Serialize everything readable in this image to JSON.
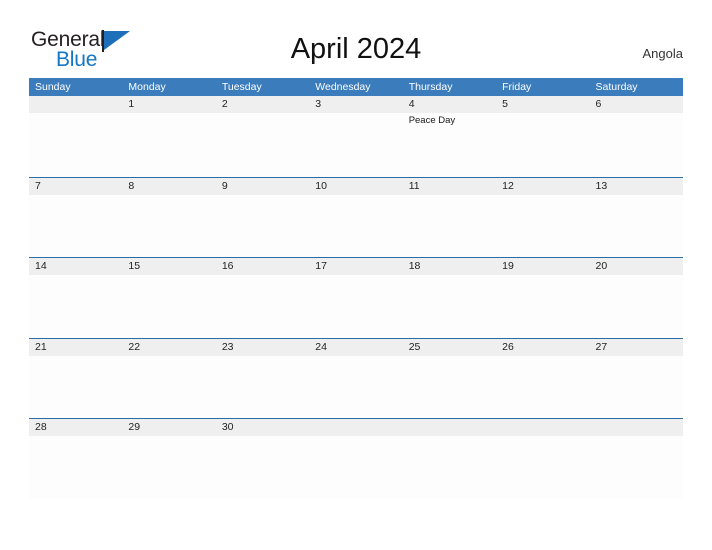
{
  "brand": {
    "name_part1": "General",
    "name_part2": "Blue",
    "flag_icon": "blue-flag-icon",
    "color_dark": "#231f20",
    "color_blue": "#1477c4"
  },
  "header": {
    "title": "April 2024",
    "locale": "Angola"
  },
  "theme": {
    "header_blue": "#3b7cbd",
    "row_divider_blue": "#2a6ca8",
    "band_gray": "#efefef",
    "cell_white": "#fdfdfd"
  },
  "calendar": {
    "month": "April",
    "year": "2024",
    "weekday_headers": [
      "Sunday",
      "Monday",
      "Tuesday",
      "Wednesday",
      "Thursday",
      "Friday",
      "Saturday"
    ],
    "weeks": [
      [
        {
          "date": "",
          "events": []
        },
        {
          "date": "1",
          "events": []
        },
        {
          "date": "2",
          "events": []
        },
        {
          "date": "3",
          "events": []
        },
        {
          "date": "4",
          "events": [
            "Peace Day"
          ]
        },
        {
          "date": "5",
          "events": []
        },
        {
          "date": "6",
          "events": []
        }
      ],
      [
        {
          "date": "7",
          "events": []
        },
        {
          "date": "8",
          "events": []
        },
        {
          "date": "9",
          "events": []
        },
        {
          "date": "10",
          "events": []
        },
        {
          "date": "11",
          "events": []
        },
        {
          "date": "12",
          "events": []
        },
        {
          "date": "13",
          "events": []
        }
      ],
      [
        {
          "date": "14",
          "events": []
        },
        {
          "date": "15",
          "events": []
        },
        {
          "date": "16",
          "events": []
        },
        {
          "date": "17",
          "events": []
        },
        {
          "date": "18",
          "events": []
        },
        {
          "date": "19",
          "events": []
        },
        {
          "date": "20",
          "events": []
        }
      ],
      [
        {
          "date": "21",
          "events": []
        },
        {
          "date": "22",
          "events": []
        },
        {
          "date": "23",
          "events": []
        },
        {
          "date": "24",
          "events": []
        },
        {
          "date": "25",
          "events": []
        },
        {
          "date": "26",
          "events": []
        },
        {
          "date": "27",
          "events": []
        }
      ],
      [
        {
          "date": "28",
          "events": []
        },
        {
          "date": "29",
          "events": []
        },
        {
          "date": "30",
          "events": []
        },
        {
          "date": "",
          "events": []
        },
        {
          "date": "",
          "events": []
        },
        {
          "date": "",
          "events": []
        },
        {
          "date": "",
          "events": []
        }
      ]
    ]
  }
}
